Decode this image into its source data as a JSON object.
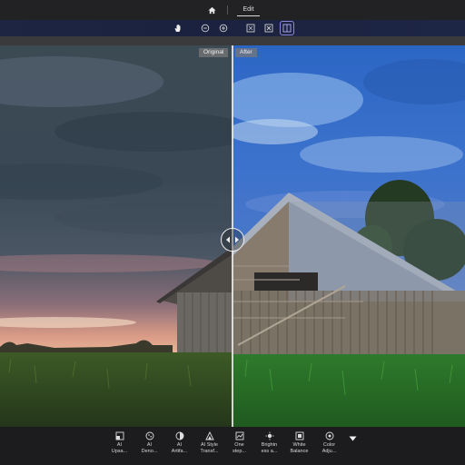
{
  "nav": {
    "home_icon": "home-icon",
    "tab_label": "Edit"
  },
  "toolbar": {
    "tools": [
      "hand-icon",
      "zoom-out-icon",
      "zoom-in-icon",
      "fit-screen-icon",
      "fullscreen-icon",
      "split-compare-icon"
    ],
    "active_tool": "split-compare-icon",
    "accent": "#8e86d8"
  },
  "compare": {
    "original_label": "Original",
    "after_label": "After"
  },
  "tools": [
    {
      "label_1": "AI",
      "label_2": "Upsa...",
      "icon": "upscale-icon"
    },
    {
      "label_1": "AI",
      "label_2": "Deno...",
      "icon": "denoise-icon"
    },
    {
      "label_1": "AI",
      "label_2": "Artifa...",
      "icon": "artifact-icon"
    },
    {
      "label_1": "AI Style",
      "label_2": "Transf...",
      "icon": "style-transfer-icon"
    },
    {
      "label_1": "One",
      "label_2": "step...",
      "icon": "one-step-icon"
    },
    {
      "label_1": "Brightn",
      "label_2": "ess a...",
      "icon": "brightness-icon"
    },
    {
      "label_1": "White",
      "label_2": "Balance",
      "icon": "white-balance-icon"
    },
    {
      "label_1": "Color",
      "label_2": "Adju...",
      "icon": "color-adjust-icon"
    }
  ],
  "more_icon": "chevron-down-icon"
}
